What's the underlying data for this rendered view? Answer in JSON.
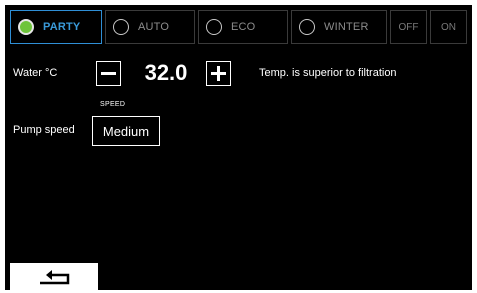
{
  "modes": [
    {
      "label": "PARTY",
      "selected": true
    },
    {
      "label": "AUTO",
      "selected": false
    },
    {
      "label": "ECO",
      "selected": false
    },
    {
      "label": "WINTER",
      "selected": false
    }
  ],
  "power": {
    "off_label": "OFF",
    "on_label": "ON"
  },
  "water": {
    "label": "Water °C",
    "value": "32.0",
    "note": "Temp. is superior to filtration"
  },
  "pump": {
    "caption": "SPEED",
    "label": "Pump speed",
    "value": "Medium"
  },
  "icons": {
    "decrease": "minus-icon",
    "increase": "plus-icon",
    "back": "return-arrow-icon"
  },
  "colors": {
    "background": "#000000",
    "accent": "#2f8fd6",
    "active_indicator": "#6ec43a"
  }
}
